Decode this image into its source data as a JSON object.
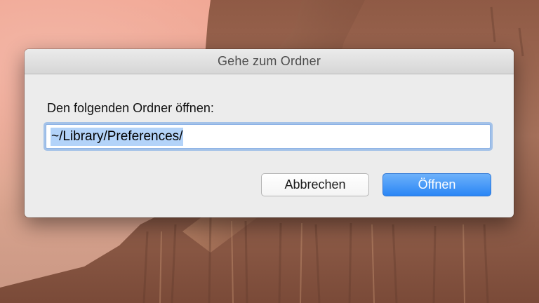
{
  "dialog": {
    "title": "Gehe zum Ordner",
    "prompt": "Den folgenden Ordner öffnen:",
    "path_value": "~/Library/Preferences/",
    "cancel_label": "Abbrechen",
    "open_label": "Öffnen"
  },
  "colors": {
    "accent": "#2a86f5",
    "selection": "#b3d3f9",
    "focus_ring": "#6aa0e6",
    "dialog_bg": "#ececec"
  }
}
